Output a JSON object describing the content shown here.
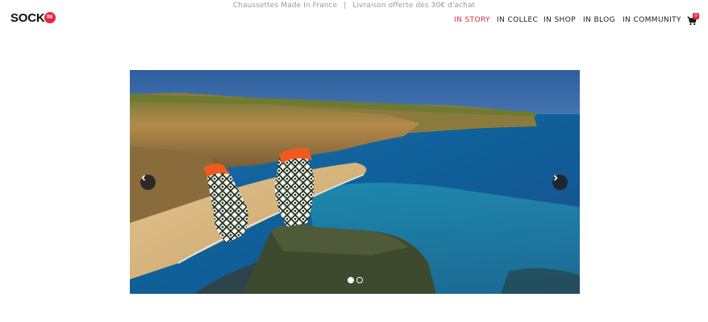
{
  "topbar": {
    "left_text": "Chaussettes Made In France",
    "separator": "|",
    "right_text": "Livraison offerte dès 30€ d'achat"
  },
  "logo": {
    "text": "SOCK",
    "badge": "IN"
  },
  "nav": {
    "items": [
      {
        "label": "IN STORY",
        "active": true
      },
      {
        "label": "IN COLLEC",
        "active": false
      },
      {
        "label": "IN SHOP",
        "active": false
      },
      {
        "label": "IN BLOG",
        "active": false
      },
      {
        "label": "IN COMMUNITY",
        "active": false
      }
    ]
  },
  "cart": {
    "icon": "shopping-cart-icon",
    "count": "0"
  },
  "slider": {
    "image": "feet-in-patterned-socks-over-coastal-cliffs",
    "prev_icon": "chevron-left-icon",
    "next_icon": "chevron-right-icon",
    "slide_count": 2,
    "active_slide": 1
  },
  "colors": {
    "accent": "#e8243c",
    "text": "#1a1a1a",
    "muted": "#9a9a9a"
  }
}
